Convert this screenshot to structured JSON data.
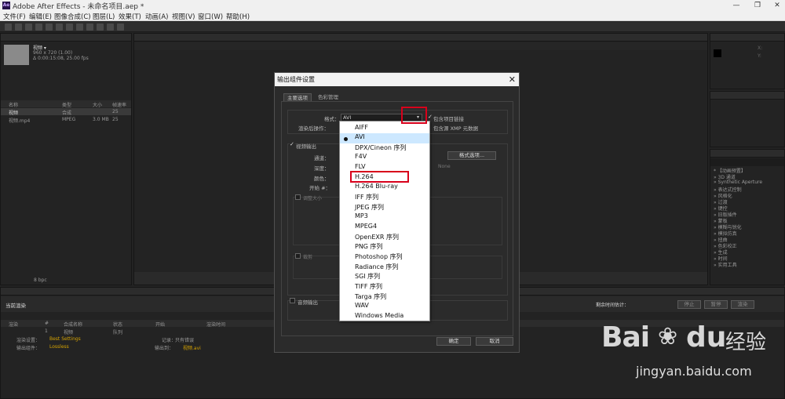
{
  "window": {
    "title": "Adobe After Effects - 未命名项目.aep *",
    "logo": "Ae",
    "minimize": "—",
    "restore": "❐",
    "close": "✕"
  },
  "menu": [
    "文件(F)",
    "编辑(E)",
    "图像合成(C)",
    "图层(L)",
    "效果(T)",
    "动画(A)",
    "视图(V)",
    "窗口(W)",
    "帮助(H)"
  ],
  "project": {
    "name": "视频 ▾",
    "info1": "960 x 720 (1.00)",
    "info2": "Δ 0:00:15:08, 25.00 fps",
    "columns": [
      "名称",
      "类型",
      "大小",
      "帧速率"
    ],
    "rows": [
      {
        "name": "视频",
        "type": "合成",
        "size": "",
        "fps": "25"
      },
      {
        "name": "视频.mp4",
        "type": "MPEG",
        "size": "3.0 MB",
        "fps": "25"
      }
    ],
    "bpc": "8 bpc"
  },
  "info_panel": {
    "x": "X:",
    "y": "Y:"
  },
  "effects_panel": {
    "items": [
      "* 【动画预置】",
      "» 3D 通道",
      "» Synthetic Aperture",
      "» 表达式控制",
      "» 风格化",
      "» 过渡",
      "» 键控",
      "» 旧版插件",
      "» 蒙板",
      "» 模糊与锐化",
      "» 模拟仿真",
      "» 扭曲",
      "» 色彩校正",
      "» 生成",
      "» 时间",
      "» 实用工具"
    ]
  },
  "render_queue": {
    "label": "当前渲染",
    "remaining": "剩余时间估计：",
    "stop": "停止",
    "pause": "暂停",
    "render": "渲染",
    "columns": [
      "渲染",
      "#",
      "合成名称",
      "状态",
      "开始",
      "渲染时间"
    ],
    "row": {
      "num": "1",
      "name": "视频",
      "status": "队列"
    },
    "settings_label": "渲染设置：",
    "settings_value": "Best Settings",
    "log_label": "记录：",
    "log_value": "只有错误",
    "output_label": "输出组件：",
    "output_value": "Lossless",
    "output_to_label": "输出到：",
    "output_to_value": "视频.avi"
  },
  "dialog": {
    "title": "输出组件设置",
    "close": "✕",
    "tabs": [
      "主要选项",
      "色彩管理"
    ],
    "format_label": "格式：",
    "format_value": "AVI",
    "include_project_link": "包含项目链接",
    "include_xmp": "包含源 XMP 元数据",
    "post_render_label": "渲染后操作：",
    "video_output": "视频输出",
    "channels_label": "通道：",
    "depth_label": "深度：",
    "color_label": "颜色：",
    "start_label": "开始 #：",
    "format_options_button": "格式选项...",
    "codec_value": "None",
    "resize": "调整大小",
    "crop": "裁剪",
    "audio_output": "音频输出",
    "ok": "确定",
    "cancel": "取消"
  },
  "format_dropdown": {
    "options": [
      "AIFF",
      "AVI",
      "DPX/Cineon 序列",
      "F4V",
      "FLV",
      "H.264",
      "H.264 Blu-ray",
      "IFF 序列",
      "JPEG 序列",
      "MP3",
      "MPEG4",
      "OpenEXR 序列",
      "PNG 序列",
      "Photoshop 序列",
      "Radiance 序列",
      "SGI 序列",
      "TIFF 序列",
      "Targa 序列",
      "WAV",
      "Windows Media"
    ],
    "selected": "AVI",
    "highlighted": "H.264"
  },
  "watermark": {
    "brand": "Bai",
    "brand_tail": "du",
    "suffix": "经验",
    "url": "jingyan.baidu.com"
  },
  "colors": {
    "highlight_box": "#d8001b",
    "selected_option_bg": "#cde8ff",
    "orange_link": "#d6a300"
  }
}
